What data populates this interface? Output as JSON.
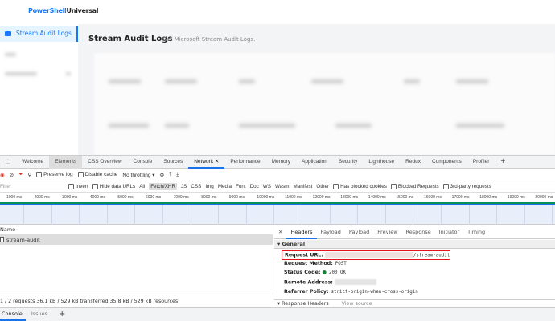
{
  "app": {
    "logo_part1": "PowerShell",
    "logo_part2": "Universal"
  },
  "sidebar": {
    "selected": "Stream Audit Logs"
  },
  "page": {
    "title": "Stream Audit Logs",
    "subtitle": "Get Microsoft Stream Audit Logs."
  },
  "devtools": {
    "tabs": [
      "Welcome",
      "Elements",
      "CSS Overview",
      "Console",
      "Sources",
      "Network",
      "Performance",
      "Memory",
      "Application",
      "Security",
      "Lighthouse",
      "Redux",
      "Components",
      "Profiler"
    ],
    "active_tab": "Network",
    "toolbar": {
      "preserve_log": "Preserve log",
      "disable_cache": "Disable cache",
      "throttling": "No throttling"
    },
    "filter": {
      "placeholder": "Filter",
      "invert": "Invert",
      "hide_data": "Hide data URLs",
      "types": [
        "All",
        "Fetch/XHR",
        "JS",
        "CSS",
        "Img",
        "Media",
        "Font",
        "Doc",
        "WS",
        "Wasm",
        "Manifest",
        "Other"
      ],
      "active_type": "Fetch/XHR",
      "blocked_cookies": "Has blocked cookies",
      "blocked_requests": "Blocked Requests",
      "third_party": "3rd-party requests"
    },
    "ruler": [
      "1000 ms",
      "2000 ms",
      "3000 ms",
      "4000 ms",
      "5000 ms",
      "6000 ms",
      "7000 ms",
      "8000 ms",
      "9000 ms",
      "10000 ms",
      "11000 ms",
      "12000 ms",
      "13000 ms",
      "14000 ms",
      "15000 ms",
      "16000 ms",
      "17000 ms",
      "18000 ms",
      "19000 ms",
      "20000 ms"
    ],
    "list": {
      "header": "Name",
      "rows": [
        "stream-audit"
      ]
    },
    "status": "1 / 2 requests  36.1 kB / 529 kB transferred  35.8 kB / 529 kB resources",
    "detail_tabs": [
      "Headers",
      "Payload",
      "Payload",
      "Preview",
      "Response",
      "Initiator",
      "Timing"
    ],
    "general": {
      "title": "General",
      "request_url_label": "Request URL:",
      "request_url_suffix": "/stream-audit",
      "method_label": "Request Method:",
      "method": "POST",
      "status_label": "Status Code:",
      "status": "200 OK",
      "remote_label": "Remote Address:",
      "referrer_label": "Referrer Policy:",
      "referrer": "strict-origin-when-cross-origin"
    },
    "response_headers": "Response Headers",
    "view_source": "View source",
    "drawer_tabs": [
      "Console",
      "Issues"
    ]
  }
}
